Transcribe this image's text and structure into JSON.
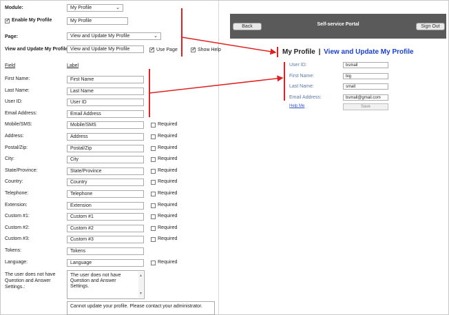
{
  "left_panel": {
    "module_label": "Module:",
    "module_value": "My Profile",
    "enable_label": "Enable My Profile",
    "enable_checked": true,
    "enable_input_value": "My Profile",
    "page_label": "Page:",
    "page_value": "View and Update My Profile",
    "view_update_label": "View and Update My Profile:",
    "view_update_value": "View and Update My Profile",
    "use_page_label": "Use Page",
    "use_page_checked": true,
    "show_help_label": "Show Help",
    "show_help_checked": true,
    "field_header": "Field",
    "label_header": "Label",
    "required_text": "Required",
    "fields": [
      {
        "field": "First Name:",
        "label": "First Name",
        "required": null
      },
      {
        "field": "Last Name:",
        "label": "Last Name",
        "required": null
      },
      {
        "field": "User ID:",
        "label": "User ID",
        "required": null
      },
      {
        "field": "Email Address:",
        "label": "Email Address",
        "required": null
      },
      {
        "field": "Mobile/SMS:",
        "label": "Mobile/SMS",
        "required": false
      },
      {
        "field": "Address:",
        "label": "Address",
        "required": false
      },
      {
        "field": "Postal/Zip:",
        "label": "Postal/Zip",
        "required": false
      },
      {
        "field": "City:",
        "label": "City",
        "required": false
      },
      {
        "field": "State/Province:",
        "label": "State/Province",
        "required": false
      },
      {
        "field": "Country:",
        "label": "Country",
        "required": false
      },
      {
        "field": "Telephone:",
        "label": "Telephone",
        "required": false
      },
      {
        "field": "Extension:",
        "label": "Extension",
        "required": false
      },
      {
        "field": "Custom #1:",
        "label": "Custom #1",
        "required": false
      },
      {
        "field": "Custom #2:",
        "label": "Custom #2",
        "required": false
      },
      {
        "field": "Custom #3:",
        "label": "Custom #3",
        "required": false
      },
      {
        "field": "Tokens:",
        "label": "Tokens",
        "required": null
      },
      {
        "field": "Language:",
        "label": "Language",
        "required": false
      }
    ],
    "qa_field_label": "The user does not have Question and Answer Settings.:",
    "qa_text": "The user does not have Question and Answer Settings.",
    "cannot_update_text": "Cannot update your profile. Please contact your administrator."
  },
  "preview": {
    "back_button": "Back",
    "portal_title": "Self-service Portal",
    "sign_out_button": "Sign Out",
    "title_main": "My Profile",
    "title_sep": "|",
    "title_sub": "View and Update My Profile",
    "title_sub_color": "#1a3fd6",
    "rows": [
      {
        "label": "User ID:",
        "value": "bsmall"
      },
      {
        "label": "First Name:",
        "value": "big"
      },
      {
        "label": "Last Name:",
        "value": "small"
      },
      {
        "label": "Email Address:",
        "value": "bsmall@gmail.com"
      }
    ],
    "help_link": "Help Me",
    "save_button": "Save"
  },
  "colors": {
    "annotation": "#e02020",
    "header_bg": "#5a5a5a",
    "label_blue": "#5b7aa8"
  }
}
